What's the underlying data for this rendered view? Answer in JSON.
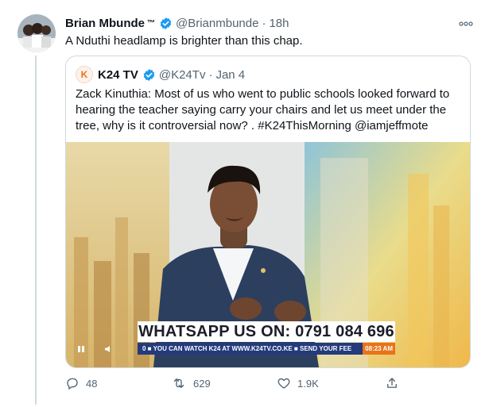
{
  "tweet": {
    "author_name": "Brian Mbunde",
    "author_name_suffix": "™",
    "handle": "@Brianmbunde",
    "separator": "·",
    "time": "18h",
    "text": "A Nduthi headlamp is brighter than this chap.",
    "more_icon": "more-horizontal-icon"
  },
  "quoted": {
    "logo_text": "K",
    "author_name": "K24 TV",
    "handle": "@K24Tv",
    "separator": "·",
    "date": "Jan 4",
    "text": "Zack Kinuthia: Most of us who went to public schools looked forward to hearing the teacher saying carry your chairs and let us meet under the tree, why is it controversial now? . #K24ThisMorning @iamjeffmote",
    "video": {
      "banner": "WHATSAPP US ON: 0791 084 696",
      "ticker": "0 ■ YOU CAN WATCH K24 AT WWW.K24TV.CO.KE ■ SEND YOUR FEE",
      "clock": "08:23 AM",
      "accent_orange": "#e9731b",
      "ticker_blue": "#233b7c"
    }
  },
  "actions": {
    "replies": "48",
    "retweets": "629",
    "likes": "1.9K"
  },
  "colors": {
    "verified_blue": "#1d9bf0",
    "muted_text": "#536471",
    "border": "#cfd9de"
  }
}
